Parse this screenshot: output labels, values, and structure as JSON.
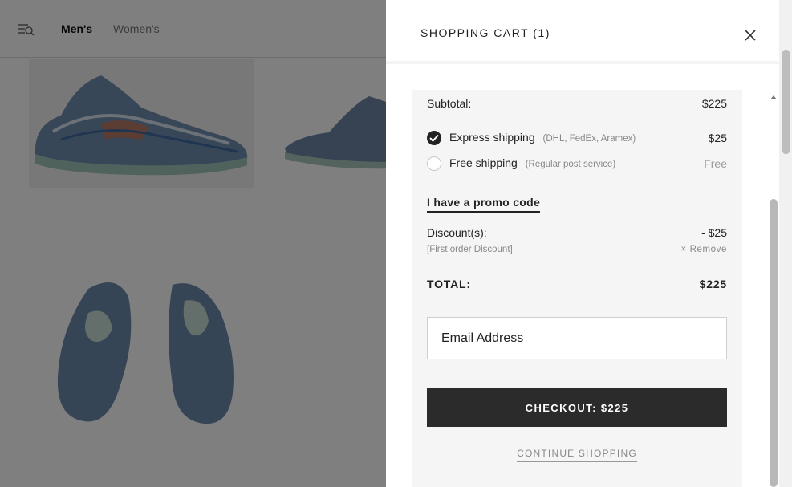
{
  "nav": {
    "men": "Men's",
    "women": "Women's"
  },
  "cart": {
    "title": "SHOPPING CART (1)",
    "subtotal_label": "Subtotal:",
    "subtotal_value": "$225",
    "shipping": [
      {
        "label": "Express shipping",
        "detail": "(DHL, FedEx, Aramex)",
        "price": "$25",
        "selected": true
      },
      {
        "label": "Free shipping",
        "detail": "(Regular post service)",
        "price": "Free",
        "selected": false
      }
    ],
    "promo_label": "I have a promo code",
    "discount_label": "Discount(s):",
    "discount_value": "- $25",
    "discount_name": "[First order Discount]",
    "discount_remove": "× Remove",
    "total_label": "TOTAL:",
    "total_value": "$225",
    "email_placeholder": "Email Address",
    "checkout_label": "CHECKOUT: $225",
    "continue_label": "CONTINUE SHOPPING"
  },
  "colors": {
    "overlay": "#000000",
    "checkout_bg": "#2b2b2b",
    "panel_bg": "#f5f5f5"
  },
  "icons": {
    "menu": "menu-search-icon",
    "close": "close-icon",
    "check": "check-icon"
  }
}
